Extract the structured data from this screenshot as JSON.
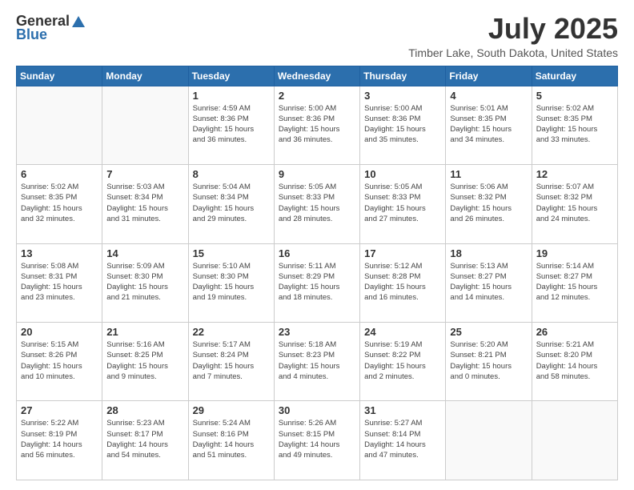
{
  "header": {
    "logo_general": "General",
    "logo_blue": "Blue",
    "month_year": "July 2025",
    "location": "Timber Lake, South Dakota, United States"
  },
  "days_of_week": [
    "Sunday",
    "Monday",
    "Tuesday",
    "Wednesday",
    "Thursday",
    "Friday",
    "Saturday"
  ],
  "weeks": [
    [
      {
        "day": "",
        "info": ""
      },
      {
        "day": "",
        "info": ""
      },
      {
        "day": "1",
        "info": "Sunrise: 4:59 AM\nSunset: 8:36 PM\nDaylight: 15 hours\nand 36 minutes."
      },
      {
        "day": "2",
        "info": "Sunrise: 5:00 AM\nSunset: 8:36 PM\nDaylight: 15 hours\nand 36 minutes."
      },
      {
        "day": "3",
        "info": "Sunrise: 5:00 AM\nSunset: 8:36 PM\nDaylight: 15 hours\nand 35 minutes."
      },
      {
        "day": "4",
        "info": "Sunrise: 5:01 AM\nSunset: 8:35 PM\nDaylight: 15 hours\nand 34 minutes."
      },
      {
        "day": "5",
        "info": "Sunrise: 5:02 AM\nSunset: 8:35 PM\nDaylight: 15 hours\nand 33 minutes."
      }
    ],
    [
      {
        "day": "6",
        "info": "Sunrise: 5:02 AM\nSunset: 8:35 PM\nDaylight: 15 hours\nand 32 minutes."
      },
      {
        "day": "7",
        "info": "Sunrise: 5:03 AM\nSunset: 8:34 PM\nDaylight: 15 hours\nand 31 minutes."
      },
      {
        "day": "8",
        "info": "Sunrise: 5:04 AM\nSunset: 8:34 PM\nDaylight: 15 hours\nand 29 minutes."
      },
      {
        "day": "9",
        "info": "Sunrise: 5:05 AM\nSunset: 8:33 PM\nDaylight: 15 hours\nand 28 minutes."
      },
      {
        "day": "10",
        "info": "Sunrise: 5:05 AM\nSunset: 8:33 PM\nDaylight: 15 hours\nand 27 minutes."
      },
      {
        "day": "11",
        "info": "Sunrise: 5:06 AM\nSunset: 8:32 PM\nDaylight: 15 hours\nand 26 minutes."
      },
      {
        "day": "12",
        "info": "Sunrise: 5:07 AM\nSunset: 8:32 PM\nDaylight: 15 hours\nand 24 minutes."
      }
    ],
    [
      {
        "day": "13",
        "info": "Sunrise: 5:08 AM\nSunset: 8:31 PM\nDaylight: 15 hours\nand 23 minutes."
      },
      {
        "day": "14",
        "info": "Sunrise: 5:09 AM\nSunset: 8:30 PM\nDaylight: 15 hours\nand 21 minutes."
      },
      {
        "day": "15",
        "info": "Sunrise: 5:10 AM\nSunset: 8:30 PM\nDaylight: 15 hours\nand 19 minutes."
      },
      {
        "day": "16",
        "info": "Sunrise: 5:11 AM\nSunset: 8:29 PM\nDaylight: 15 hours\nand 18 minutes."
      },
      {
        "day": "17",
        "info": "Sunrise: 5:12 AM\nSunset: 8:28 PM\nDaylight: 15 hours\nand 16 minutes."
      },
      {
        "day": "18",
        "info": "Sunrise: 5:13 AM\nSunset: 8:27 PM\nDaylight: 15 hours\nand 14 minutes."
      },
      {
        "day": "19",
        "info": "Sunrise: 5:14 AM\nSunset: 8:27 PM\nDaylight: 15 hours\nand 12 minutes."
      }
    ],
    [
      {
        "day": "20",
        "info": "Sunrise: 5:15 AM\nSunset: 8:26 PM\nDaylight: 15 hours\nand 10 minutes."
      },
      {
        "day": "21",
        "info": "Sunrise: 5:16 AM\nSunset: 8:25 PM\nDaylight: 15 hours\nand 9 minutes."
      },
      {
        "day": "22",
        "info": "Sunrise: 5:17 AM\nSunset: 8:24 PM\nDaylight: 15 hours\nand 7 minutes."
      },
      {
        "day": "23",
        "info": "Sunrise: 5:18 AM\nSunset: 8:23 PM\nDaylight: 15 hours\nand 4 minutes."
      },
      {
        "day": "24",
        "info": "Sunrise: 5:19 AM\nSunset: 8:22 PM\nDaylight: 15 hours\nand 2 minutes."
      },
      {
        "day": "25",
        "info": "Sunrise: 5:20 AM\nSunset: 8:21 PM\nDaylight: 15 hours\nand 0 minutes."
      },
      {
        "day": "26",
        "info": "Sunrise: 5:21 AM\nSunset: 8:20 PM\nDaylight: 14 hours\nand 58 minutes."
      }
    ],
    [
      {
        "day": "27",
        "info": "Sunrise: 5:22 AM\nSunset: 8:19 PM\nDaylight: 14 hours\nand 56 minutes."
      },
      {
        "day": "28",
        "info": "Sunrise: 5:23 AM\nSunset: 8:17 PM\nDaylight: 14 hours\nand 54 minutes."
      },
      {
        "day": "29",
        "info": "Sunrise: 5:24 AM\nSunset: 8:16 PM\nDaylight: 14 hours\nand 51 minutes."
      },
      {
        "day": "30",
        "info": "Sunrise: 5:26 AM\nSunset: 8:15 PM\nDaylight: 14 hours\nand 49 minutes."
      },
      {
        "day": "31",
        "info": "Sunrise: 5:27 AM\nSunset: 8:14 PM\nDaylight: 14 hours\nand 47 minutes."
      },
      {
        "day": "",
        "info": ""
      },
      {
        "day": "",
        "info": ""
      }
    ]
  ]
}
